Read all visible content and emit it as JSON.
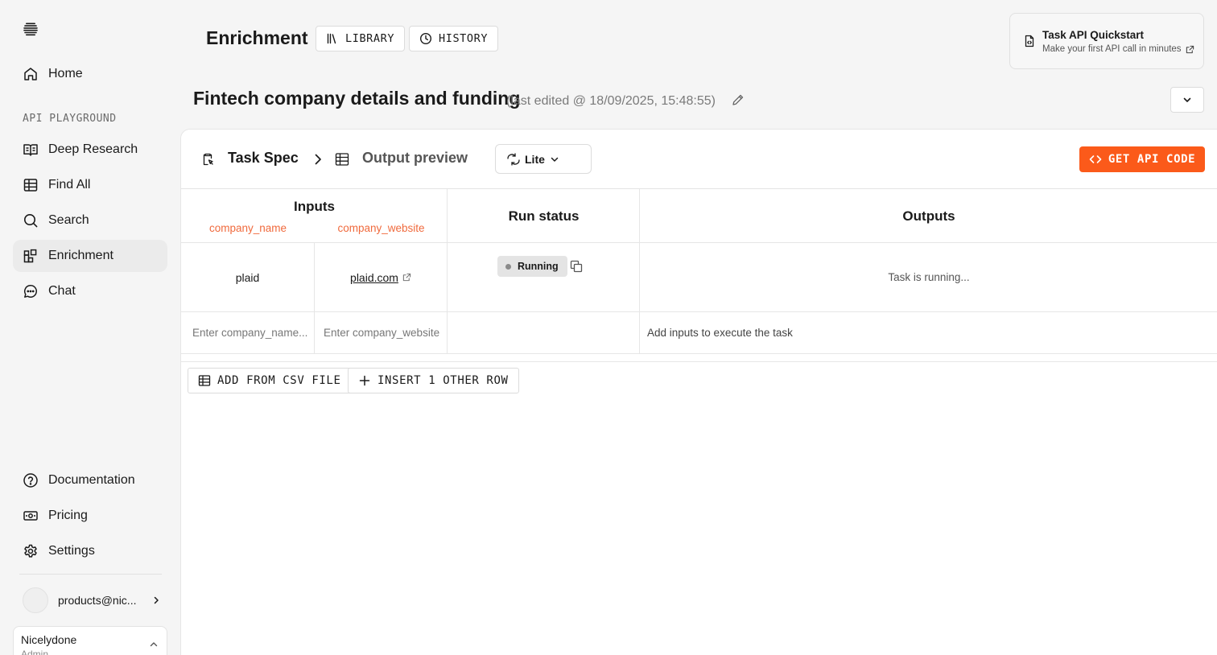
{
  "sidebar": {
    "items_top": [
      {
        "label": "Home",
        "icon": "home-icon"
      }
    ],
    "section_label": "API PLAYGROUND",
    "items_playground": [
      {
        "label": "Deep Research",
        "icon": "book-open-icon"
      },
      {
        "label": "Find All",
        "icon": "table-icon"
      },
      {
        "label": "Search",
        "icon": "search-icon"
      },
      {
        "label": "Enrichment",
        "icon": "grid-plus-icon",
        "active": true
      },
      {
        "label": "Chat",
        "icon": "chat-icon"
      }
    ],
    "items_bottom": [
      {
        "label": "Documentation",
        "icon": "help-circle-icon"
      },
      {
        "label": "Pricing",
        "icon": "banknote-icon"
      },
      {
        "label": "Settings",
        "icon": "gear-icon"
      }
    ],
    "account_email": "products@nic...",
    "org_name": "Nicelydone",
    "org_role": "Admin"
  },
  "header": {
    "title": "Enrichment",
    "library_label": "LIBRARY",
    "history_label": "HISTORY",
    "quickstart_title": "Task API Quickstart",
    "quickstart_sub": "Make your first API call in minutes"
  },
  "task": {
    "title": "Fintech company details and funding",
    "edited": "(last edited @ 18/09/2025, 15:48:55)"
  },
  "toolbar": {
    "crumb_1": "Task Spec",
    "crumb_2": "Output preview",
    "model": "Lite",
    "api_button": "GET API CODE"
  },
  "table": {
    "inputs_header": "Inputs",
    "input_cols": [
      "company_name",
      "company_website"
    ],
    "run_status_header": "Run status",
    "outputs_header": "Outputs",
    "row": {
      "company_name": "plaid",
      "company_website": "plaid.com",
      "status": "Running",
      "output": "Task is running..."
    },
    "new_row": {
      "company_name_placeholder": "Enter company_name...",
      "company_website_placeholder": "Enter company_website",
      "output_hint": "Add inputs to execute the task"
    }
  },
  "actions": {
    "csv_label": "ADD FROM CSV FILE",
    "insert_label": "INSERT 1 OTHER ROW"
  },
  "colors": {
    "accent": "#fb5a1a",
    "input_col": "#f06a3d"
  }
}
